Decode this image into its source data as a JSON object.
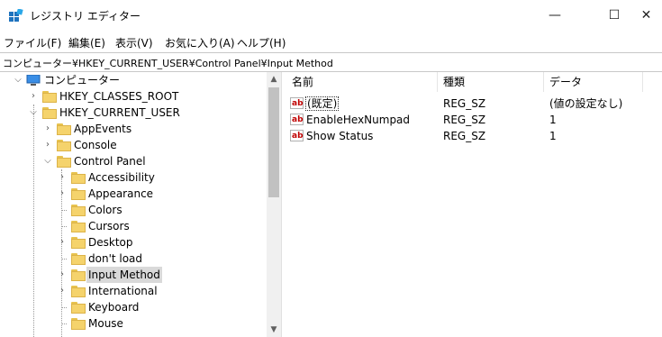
{
  "window": {
    "title": "レジストリ エディター",
    "min_glyph": "—",
    "max_glyph": "☐",
    "close_glyph": "✕"
  },
  "menu": [
    {
      "label": "ファイル(F)"
    },
    {
      "label": "編集(E)"
    },
    {
      "label": "表示(V)"
    },
    {
      "label": "お気に入り(A)"
    },
    {
      "label": "ヘルプ(H)"
    }
  ],
  "address": "コンピューター¥HKEY_CURRENT_USER¥Control Panel¥Input Method",
  "tree": [
    {
      "label": "コンピューター",
      "expander": "expanded",
      "icon": "computer-icon"
    },
    {
      "label": "HKEY_CLASSES_ROOT",
      "expander": "collapsed"
    },
    {
      "label": "HKEY_CURRENT_USER",
      "expander": "expanded"
    },
    {
      "label": "AppEvents",
      "expander": "collapsed"
    },
    {
      "label": "Console",
      "expander": "collapsed"
    },
    {
      "label": "Control Panel",
      "expander": "expanded"
    },
    {
      "label": "Accessibility",
      "expander": "collapsed"
    },
    {
      "label": "Appearance",
      "expander": "collapsed"
    },
    {
      "label": "Colors",
      "expander": "none"
    },
    {
      "label": "Cursors",
      "expander": "none"
    },
    {
      "label": "Desktop",
      "expander": "collapsed"
    },
    {
      "label": "don't load",
      "expander": "none"
    },
    {
      "label": "Input Method",
      "expander": "collapsed",
      "selected": true
    },
    {
      "label": "International",
      "expander": "collapsed"
    },
    {
      "label": "Keyboard",
      "expander": "none"
    },
    {
      "label": "Mouse",
      "expander": "none"
    }
  ],
  "list": {
    "headers": [
      "名前",
      "種類",
      "データ"
    ],
    "rows": [
      {
        "name": "(既定)",
        "type": "REG_SZ",
        "data": "(値の設定なし)",
        "icon": "string-value-icon",
        "focused": true
      },
      {
        "name": "EnableHexNumpad",
        "type": "REG_SZ",
        "data": "1",
        "icon": "string-value-icon"
      },
      {
        "name": "Show Status",
        "type": "REG_SZ",
        "data": "1",
        "icon": "string-value-icon"
      }
    ]
  },
  "icons": {
    "string_value_glyph": "ab",
    "expanded_glyph": "⌵",
    "collapsed_glyph": "›",
    "scroll_up_glyph": "▲",
    "scroll_down_glyph": "▼"
  },
  "colors": {
    "selection": "#d9d9d9",
    "folder": "#f5d36c",
    "string_icon_text": "#c00000"
  }
}
